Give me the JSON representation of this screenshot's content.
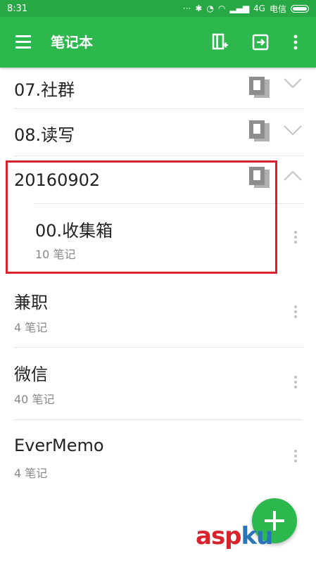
{
  "status": {
    "time": "8:31",
    "carrier": "电信",
    "network": "4G"
  },
  "app_bar": {
    "title": "笔记本"
  },
  "notebooks": [
    {
      "title": "07.社群"
    },
    {
      "title": "08.读写"
    },
    {
      "title": "20160902",
      "children": [
        {
          "title": "00.收集箱",
          "count": "10 笔记"
        }
      ]
    },
    {
      "title": "兼职",
      "count": "4 笔记"
    },
    {
      "title": "微信",
      "count": "40 笔记"
    },
    {
      "title": "EverMemo",
      "count": "4 笔记"
    }
  ],
  "watermark": {
    "text_a": "asp",
    "text_b": "ku"
  },
  "colors": {
    "accent": "#2db84d",
    "highlight": "#d9232c"
  }
}
